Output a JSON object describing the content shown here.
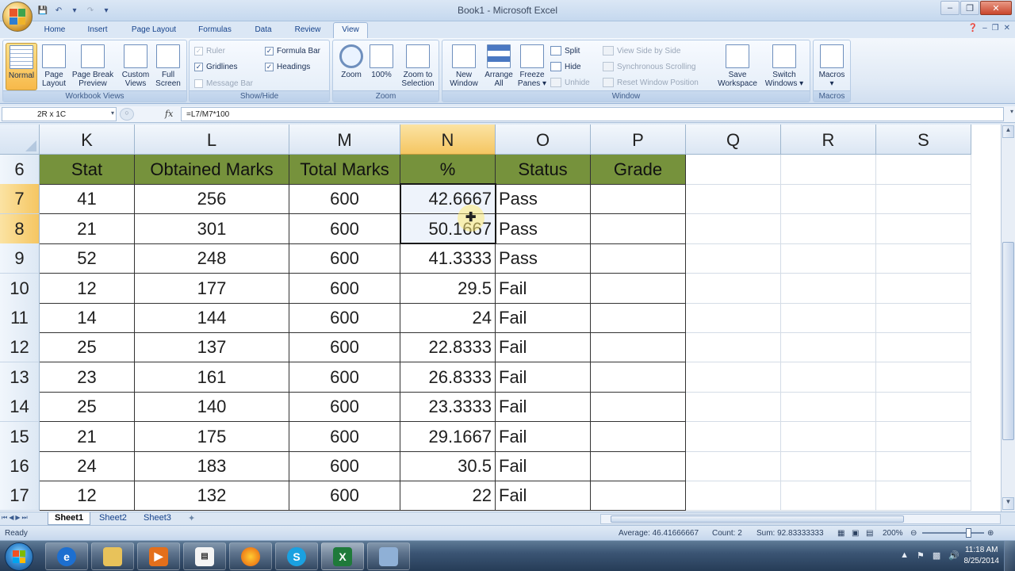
{
  "window": {
    "title": "Book1 - Microsoft Excel",
    "minimize": "–",
    "restore": "❐",
    "close": "✕"
  },
  "ribbon": {
    "tabs": [
      "Home",
      "Insert",
      "Page Layout",
      "Formulas",
      "Data",
      "Review",
      "View"
    ],
    "active_tab": "View",
    "groups": {
      "workbook_views": {
        "label": "Workbook Views",
        "normal": "Normal",
        "page_layout": [
          "Page",
          "Layout"
        ],
        "page_break": [
          "Page Break",
          "Preview"
        ],
        "custom_views": [
          "Custom",
          "Views"
        ],
        "full_screen": [
          "Full",
          "Screen"
        ]
      },
      "show_hide": {
        "label": "Show/Hide",
        "ruler": "Ruler",
        "gridlines": "Gridlines",
        "message_bar": "Message Bar",
        "formula_bar": "Formula Bar",
        "headings": "Headings",
        "ruler_checked": true,
        "gridlines_checked": true,
        "formula_bar_checked": true,
        "headings_checked": true
      },
      "zoom": {
        "label": "Zoom",
        "zoom": "Zoom",
        "pct100": "100%",
        "zoom_to_selection": [
          "Zoom to",
          "Selection"
        ]
      },
      "window": {
        "label": "Window",
        "new_window": [
          "New",
          "Window"
        ],
        "arrange_all": [
          "Arrange",
          "All"
        ],
        "freeze_panes": [
          "Freeze",
          "Panes"
        ],
        "split": "Split",
        "hide": "Hide",
        "unhide": "Unhide",
        "view_side_by_side": "View Side by Side",
        "synchronous_scrolling": "Synchronous Scrolling",
        "reset_window_position": "Reset Window Position",
        "save_workspace": [
          "Save",
          "Workspace"
        ],
        "switch_windows": [
          "Switch",
          "Windows"
        ]
      },
      "macros": {
        "label": "Macros",
        "macros": "Macros"
      }
    }
  },
  "formula_bar": {
    "name_box": "2R x 1C",
    "fx": "fx",
    "formula": "=L7/M7*100"
  },
  "grid": {
    "columns": [
      "K",
      "L",
      "M",
      "N",
      "O",
      "P",
      "Q",
      "R",
      "S"
    ],
    "selected_column": "N",
    "rows": [
      "6",
      "7",
      "8",
      "9",
      "10",
      "11",
      "12",
      "13",
      "14",
      "15",
      "16",
      "17"
    ],
    "selected_rows": [
      "7",
      "8"
    ],
    "header_row": [
      "Stat",
      "Obtained Marks",
      "Total Marks",
      "%",
      "Status",
      "Grade"
    ],
    "data": [
      [
        "41",
        "256",
        "600",
        "42.6667",
        "Pass",
        ""
      ],
      [
        "21",
        "301",
        "600",
        "50.1667",
        "Pass",
        ""
      ],
      [
        "52",
        "248",
        "600",
        "41.3333",
        "Pass",
        ""
      ],
      [
        "12",
        "177",
        "600",
        "29.5",
        "Fail",
        ""
      ],
      [
        "14",
        "144",
        "600",
        "24",
        "Fail",
        ""
      ],
      [
        "25",
        "137",
        "600",
        "22.8333",
        "Fail",
        ""
      ],
      [
        "23",
        "161",
        "600",
        "26.8333",
        "Fail",
        ""
      ],
      [
        "25",
        "140",
        "600",
        "23.3333",
        "Fail",
        ""
      ],
      [
        "21",
        "175",
        "600",
        "29.1667",
        "Fail",
        ""
      ],
      [
        "24",
        "183",
        "600",
        "30.5",
        "Fail",
        ""
      ],
      [
        "12",
        "132",
        "600",
        "22",
        "Fail",
        ""
      ]
    ],
    "header_fill": "#76923c"
  },
  "sheets": {
    "tabs": [
      "Sheet1",
      "Sheet2",
      "Sheet3"
    ],
    "active": "Sheet1"
  },
  "status_bar": {
    "ready": "Ready",
    "average": "Average: 46.41666667",
    "count": "Count: 2",
    "sum": "Sum: 92.83333333",
    "zoom": "200%",
    "zoom_level_percent": 200
  },
  "taskbar": {
    "apps": [
      "internet-explorer",
      "file-explorer",
      "media-player",
      "document",
      "firefox",
      "skype",
      "excel",
      "window"
    ],
    "time": "11:18 AM",
    "date": "8/25/2014"
  }
}
